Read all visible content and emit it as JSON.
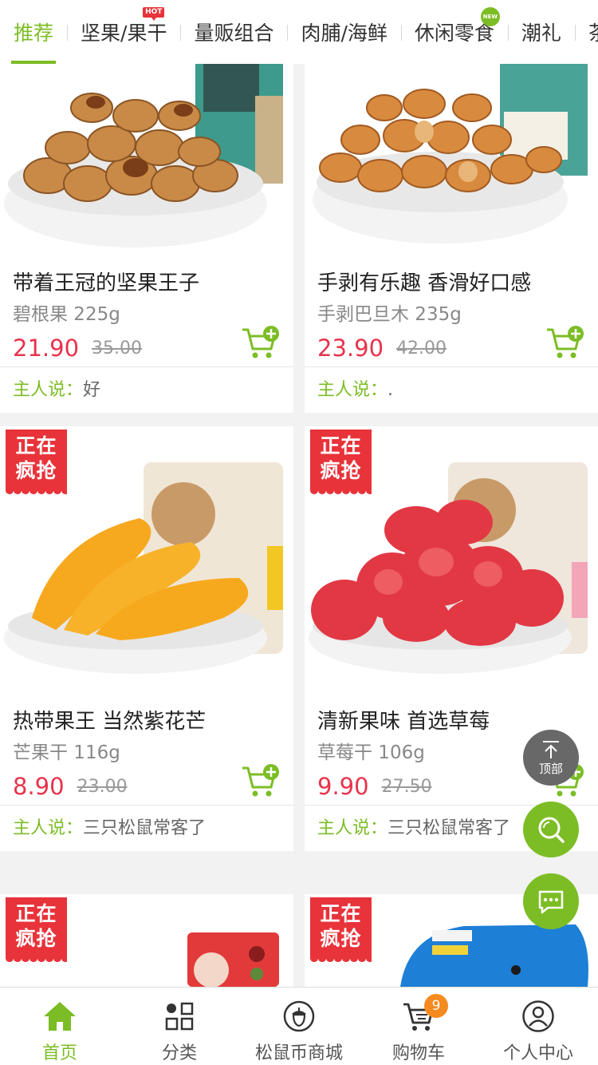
{
  "tabs": [
    {
      "label": "推荐",
      "active": true
    },
    {
      "label": "坚果/果干",
      "badge": "HOT"
    },
    {
      "label": "量贩组合"
    },
    {
      "label": "肉脯/海鲜"
    },
    {
      "label": "休闲零食",
      "badge": "NEW"
    },
    {
      "label": "潮礼"
    },
    {
      "label": "茶"
    }
  ],
  "flash_label": "正在疯抢",
  "owner_says_label": "主人说：",
  "products": [
    {
      "title": "带着王冠的坚果王子",
      "spec": "碧根果 225g",
      "price": "21.90",
      "original_price": "35.00",
      "owner_says": "好"
    },
    {
      "title": "手剥有乐趣 香滑好口感",
      "spec": "手剥巴旦木 235g",
      "price": "23.90",
      "original_price": "42.00",
      "owner_says": "."
    },
    {
      "title": "热带果王 当然紫花芒",
      "spec": "芒果干 116g",
      "price": "8.90",
      "original_price": "23.00",
      "owner_says": "三只松鼠常客了"
    },
    {
      "title": "清新果味 首选草莓",
      "spec": "草莓干 106g",
      "price": "9.90",
      "original_price": "27.50",
      "owner_says": "三只松鼠常客了"
    }
  ],
  "back_to_top": "顶部",
  "bottom_nav": [
    {
      "label": "首页",
      "icon": "home-icon",
      "active": true
    },
    {
      "label": "分类",
      "icon": "category-icon"
    },
    {
      "label": "松鼠币商城",
      "icon": "acorn-icon"
    },
    {
      "label": "购物车",
      "icon": "cart-icon",
      "count": "9"
    },
    {
      "label": "个人中心",
      "icon": "user-icon"
    }
  ],
  "colors": {
    "accent": "#7cbd25",
    "price": "#e8334c",
    "flash": "#e8333a",
    "cart_badge": "#f58a1f"
  }
}
